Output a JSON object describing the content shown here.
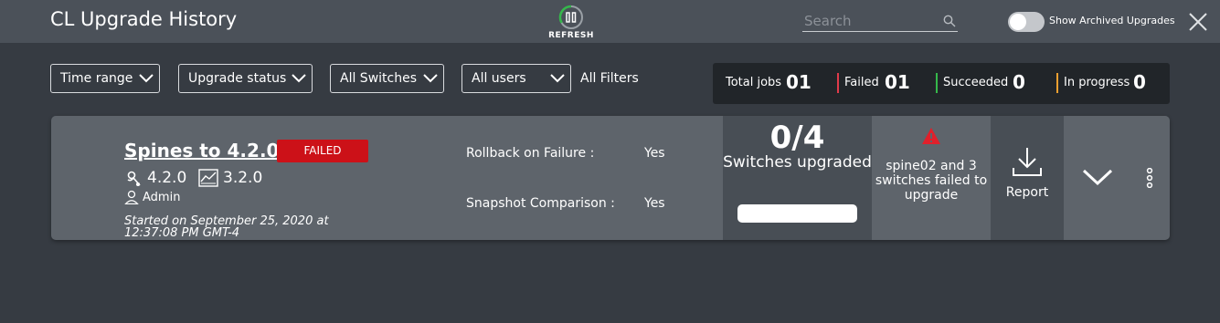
{
  "header": {
    "title": "CL Upgrade History",
    "refresh_label": "REFRESH",
    "search_placeholder": "Search",
    "archived_toggle_label": "Show Archived Upgrades",
    "archived_toggle_on": false
  },
  "filters": {
    "items": [
      {
        "label": "Time range"
      },
      {
        "label": "Upgrade status"
      },
      {
        "label": "All Switches"
      },
      {
        "label": "All users"
      }
    ],
    "all_filters_label": "All Filters"
  },
  "stats": {
    "total": {
      "label": "Total jobs",
      "value": "01"
    },
    "failed": {
      "label": "Failed",
      "value": "01",
      "color": "#e03a4a"
    },
    "succeeded": {
      "label": "Succeeded",
      "value": "0",
      "color": "#35b84b"
    },
    "in_progress": {
      "label": "In progress",
      "value": "0",
      "color": "#f0a030"
    }
  },
  "job": {
    "title": "Spines to 4.2.0",
    "status": "FAILED",
    "status_color": "#cc1118",
    "target_version": "4.2.0",
    "source_version": "3.2.0",
    "user": "Admin",
    "started": "Started on September 25, 2020 at 12:37:08 PM GMT-4",
    "rollback_label": "Rollback on Failure :",
    "rollback_value": "Yes",
    "snapshot_label": "Snapshot Comparison :",
    "snapshot_value": "Yes",
    "upgraded_count": "0/4",
    "upgraded_label": "Switches upgraded",
    "progress_fraction": 0,
    "failure_message": "spine02 and 3 switches failed to upgrade",
    "report_label": "Report"
  }
}
